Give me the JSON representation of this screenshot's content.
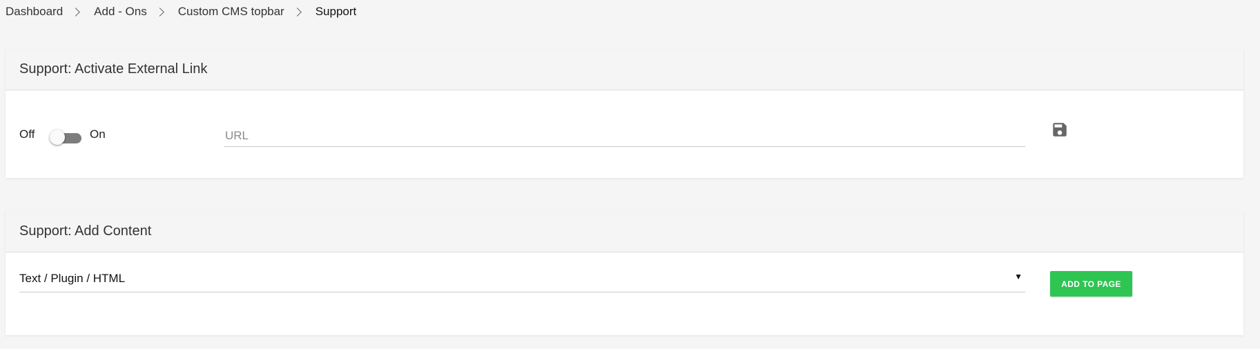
{
  "breadcrumb": {
    "items": [
      "Dashboard",
      "Add - Ons",
      "Custom CMS topbar",
      "Support"
    ]
  },
  "external_link_card": {
    "title": "Support: Activate External Link",
    "toggle": {
      "off_label": "Off",
      "on_label": "On",
      "state": "off"
    },
    "url_input": {
      "placeholder": "URL",
      "value": ""
    },
    "save_icon": "floppy-disk-icon"
  },
  "content_card": {
    "title": "Support: Add Content",
    "select": {
      "selected": "Text / Plugin / HTML",
      "arrow": "▼"
    },
    "add_button_label": "ADD TO PAGE"
  },
  "colors": {
    "background": "#f5f5f5",
    "accent_button": "#2ec552",
    "toggle_track": "#7d7d7d"
  }
}
